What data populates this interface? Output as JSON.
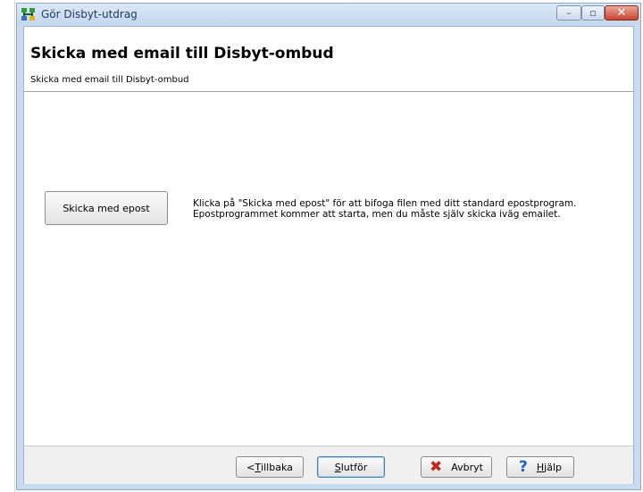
{
  "window": {
    "title": "Gör Disbyt-utdrag",
    "minimize_glyph": "–",
    "maximize_glyph": "▫",
    "close_glyph": "✕"
  },
  "header": {
    "title": "Skicka med email till Disbyt-ombud",
    "subtitle": "Skicka med email till Disbyt-ombud"
  },
  "main": {
    "send_button_label": "Skicka med epost",
    "info_line_1": "Klicka på \"Skicka med epost\" för att bifoga filen med ditt standard epostprogram.",
    "info_line_2": "Epostprogrammet kommer att starta, men du måste själv skicka iväg emailet."
  },
  "footer": {
    "back": {
      "prefix": "< ",
      "mnemonic": "T",
      "rest": "illbaka"
    },
    "finish": {
      "mnemonic": "S",
      "rest": "lutför"
    },
    "cancel": {
      "label": "Avbryt"
    },
    "help": {
      "mnemonic": "H",
      "rest": "jälp"
    }
  },
  "icons": {
    "app": "tree-icon",
    "cancel": "red-x-icon",
    "help": "blue-question-icon"
  },
  "colors": {
    "window_frame": "#c9dbef",
    "title_text": "#1e3a5f",
    "close_button": "#c8452e",
    "cancel_icon": "#c0281b",
    "help_icon": "#1d5fc4"
  }
}
